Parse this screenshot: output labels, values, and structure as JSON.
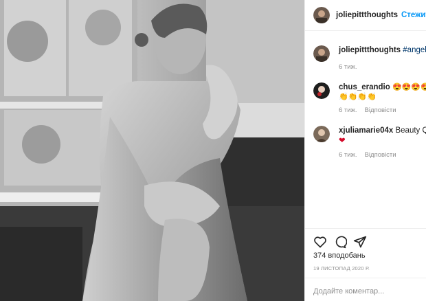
{
  "post": {
    "author": "joliepittthoughts",
    "follow_label": "Стежити",
    "photo_alt": "Black and white photo of woman seated by a window"
  },
  "caption": {
    "username": "joliepittthoughts",
    "text": "#angelina",
    "time": "6 тиж."
  },
  "comments": [
    {
      "username": "chus_erandio",
      "line1": "😍😍😍😍😍",
      "line2": "👏👏👏👏",
      "time": "6 тиж.",
      "reply_label": "Відповісти"
    },
    {
      "username": "xjuliamarie04x",
      "line1": "Beauty Queen",
      "line2": "❤",
      "time": "6 тиж.",
      "reply_label": "Відповісти"
    }
  ],
  "actions": {
    "icons": [
      "heart-icon",
      "comment-icon",
      "share-icon"
    ]
  },
  "likes_text": "374 вподобань",
  "date_text": "19 ЛИСТОПАД 2020 Р.",
  "add_comment_placeholder": "Додайте коментар..."
}
